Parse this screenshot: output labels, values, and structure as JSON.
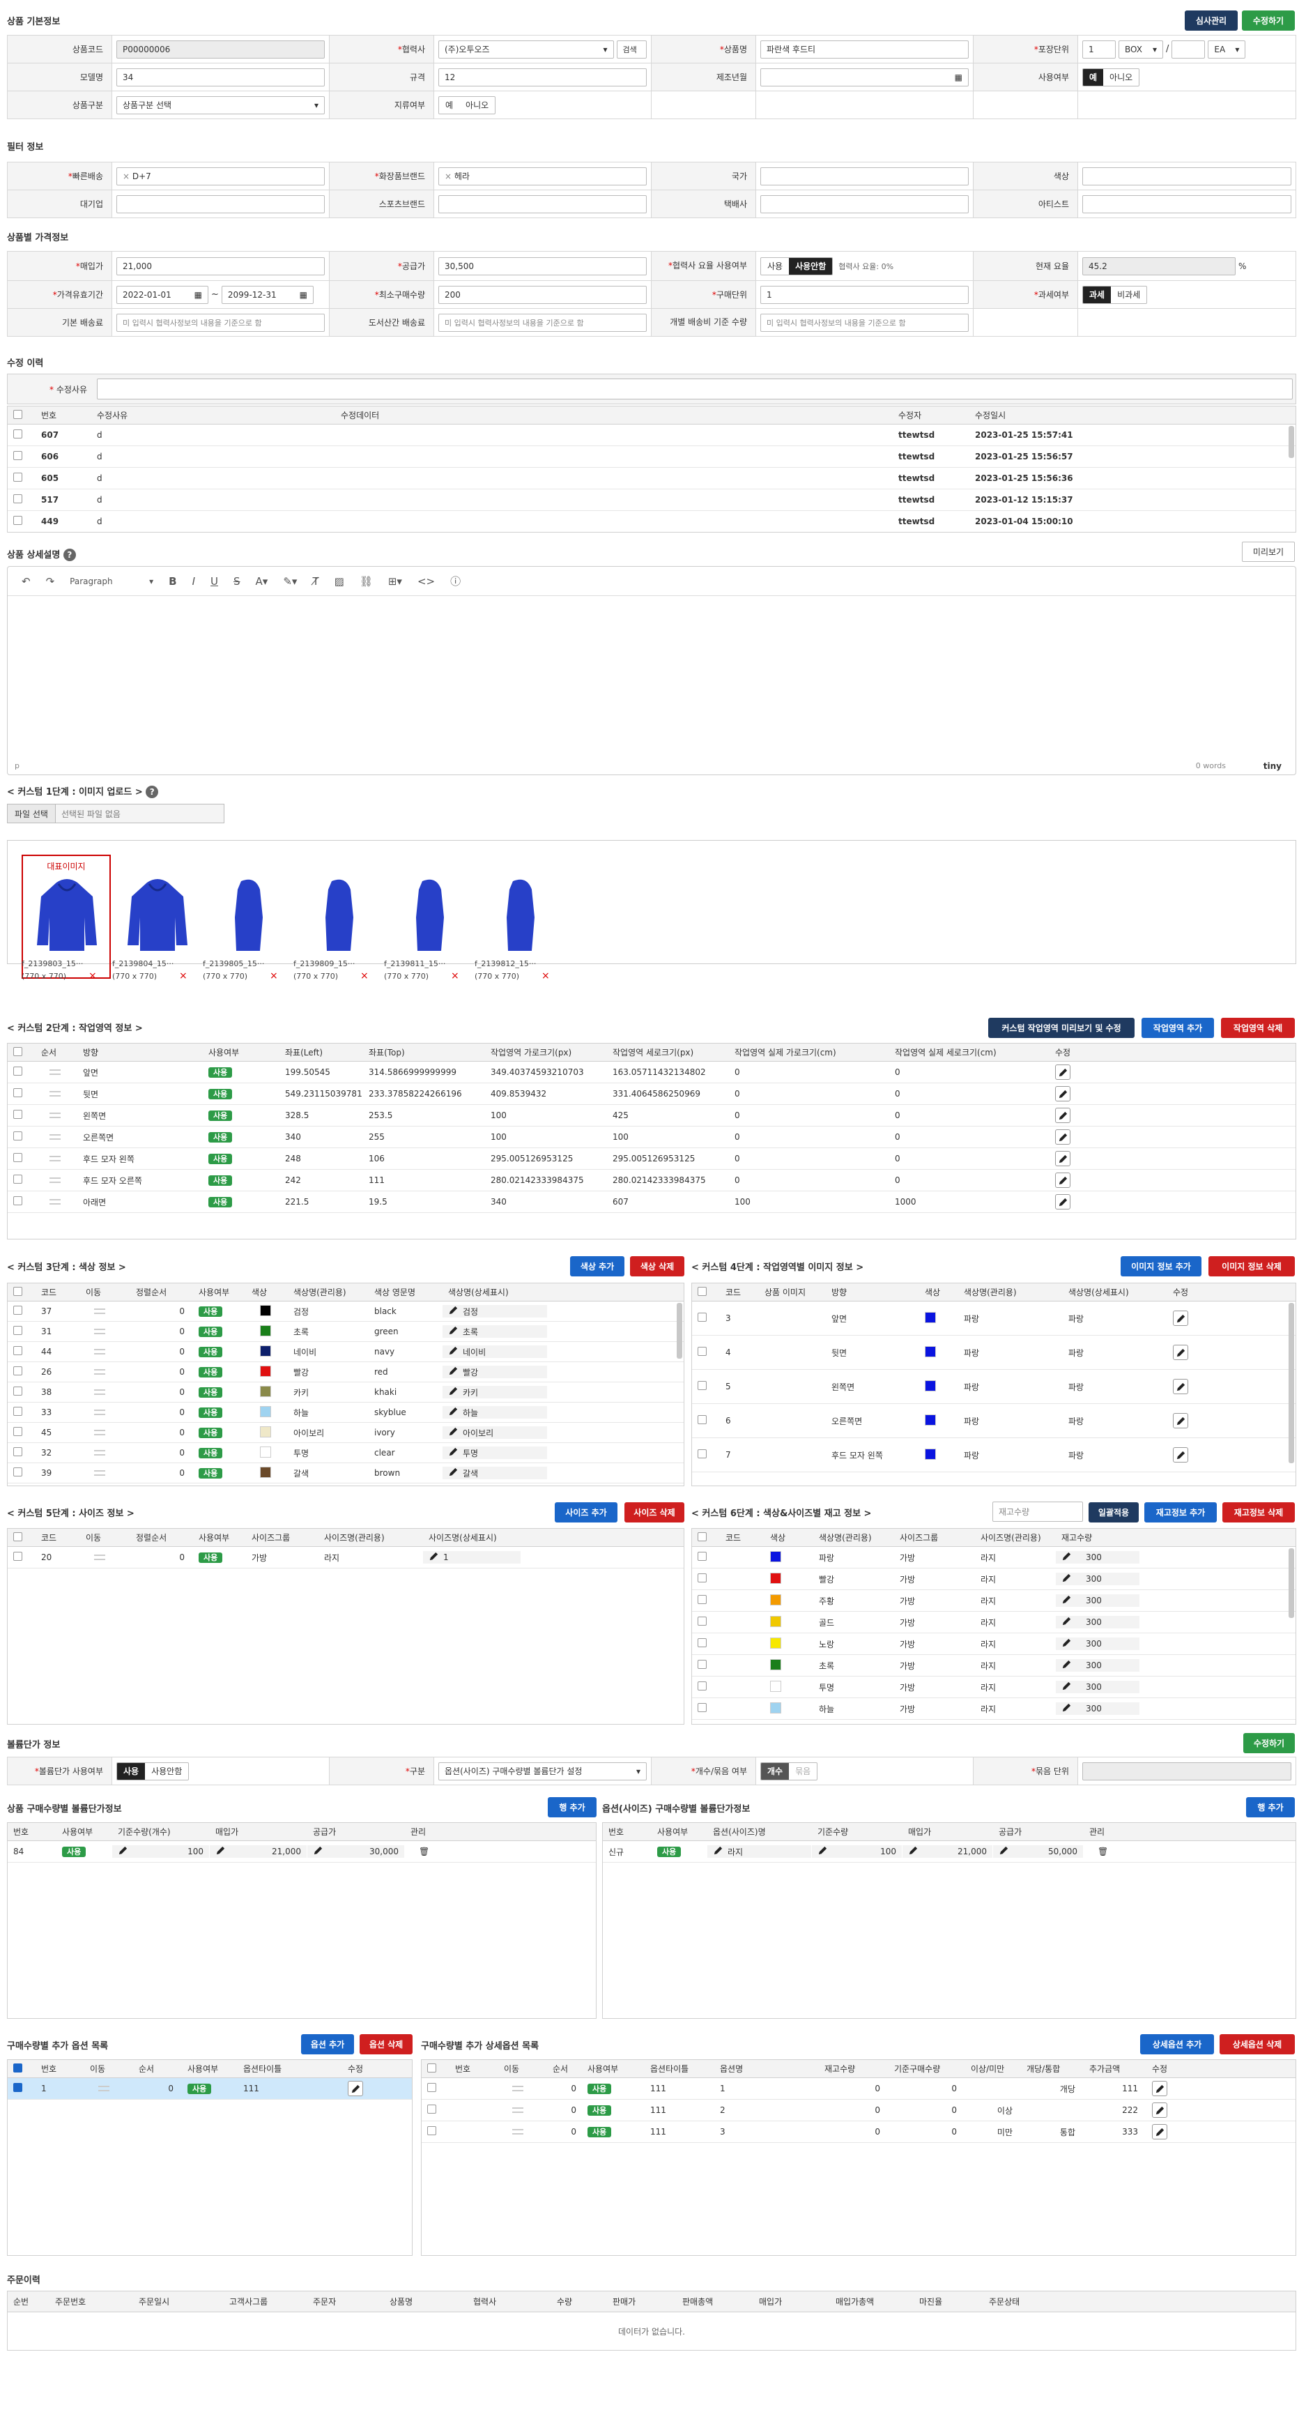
{
  "top": {
    "review_label": "심사관리",
    "save_label": "수정하기"
  },
  "basic": {
    "title": "상품 기본정보",
    "product_code_label": "상품코드",
    "product_code": "P00000006",
    "partner_label": "협력사",
    "partner": "(주)오투오즈",
    "partner_search": "검색",
    "product_name_label": "상품명",
    "product_name": "파란색 후드티",
    "pack_label": "포장단위",
    "pack_qty": "1",
    "pack_unit1": "BOX",
    "pack_unit2": "EA",
    "model_label": "모델명",
    "model": "34",
    "spec_label": "규격",
    "spec": "12",
    "made_label": "제조년월",
    "use_label": "사용여부",
    "yes": "예",
    "no": "아니오",
    "type_label": "상품구분",
    "type": "상품구분 선택",
    "dist_label": "지류여부"
  },
  "filter": {
    "title": "필터 정보",
    "fast_label": "빠른배송",
    "fast_tag": "D+7",
    "cosmetic_label": "화장품브랜드",
    "cosmetic_tag": "헤라",
    "country_label": "국가",
    "color_label": "색상",
    "corp_label": "대기업",
    "sports_label": "스포츠브랜드",
    "parcel_label": "택배사",
    "artist_label": "아티스트"
  },
  "price": {
    "title": "상품별 가격정보",
    "buy_label": "매입가",
    "buy": "21,000",
    "supply_label": "공급가",
    "supply": "30,500",
    "fee_use_label": "협력사 요율 사용여부",
    "fee_use": "사용",
    "fee_unuse": "사용안함",
    "fee_note": "협력사 요율: 0%",
    "cur_fee_label": "현재 요율",
    "cur_fee": "45.2",
    "pct": "%",
    "period_label": "가격유효기간",
    "date_from": "2022-01-01",
    "date_to": "2099-12-31",
    "tilde": "~",
    "minqty_label": "최소구매수량",
    "minqty": "200",
    "buy_unit_label": "구매단위",
    "buy_unit": "1",
    "tax_label": "과세여부",
    "tax": "과세",
    "notax": "비과세",
    "ship_label": "기본 배송료",
    "ship_ph": "미 입력시 협력사정보의 내용을 기준으로 함",
    "island_label": "도서산간 배송료",
    "island_ph": "미 입력시 협력사정보의 내용을 기준으로 함",
    "each_label": "개별 배송비 기준 수량",
    "each_ph": "미 입력시 협력사정보의 내용을 기준으로 함"
  },
  "history": {
    "title": "수정 이력",
    "reason_label": "수정사유",
    "cols": [
      "번호",
      "수정사유",
      "수정데이터",
      "수정자",
      "수정일시"
    ],
    "rows": [
      [
        "607",
        "d",
        "",
        "ttewtsd",
        "2023-01-25 15:57:41"
      ],
      [
        "606",
        "d",
        "",
        "ttewtsd",
        "2023-01-25 15:56:57"
      ],
      [
        "605",
        "d",
        "",
        "ttewtsd",
        "2023-01-25 15:56:36"
      ],
      [
        "517",
        "d",
        "",
        "ttewtsd",
        "2023-01-12 15:15:37"
      ],
      [
        "449",
        "d",
        "",
        "ttewtsd",
        "2023-01-04 15:00:10"
      ]
    ]
  },
  "desc": {
    "title": "상품 상세설명",
    "preview": "미리보기",
    "format": "Paragraph",
    "path": "p",
    "words": "0 words",
    "brand": "tiny"
  },
  "custom1": {
    "title": "< 커스텀 1단계 : 이미지 업로드 >",
    "file_btn": "파일 선택",
    "file_none": "선택된 파일 없음",
    "main_label": "대표이미지",
    "images": [
      {
        "name": "f_2139803_15···",
        "size": "(770 x 770)"
      },
      {
        "name": "f_2139804_15···",
        "size": "(770 x 770)"
      },
      {
        "name": "f_2139805_15···",
        "size": "(770 x 770)"
      },
      {
        "name": "f_2139809_15···",
        "size": "(770 x 770)"
      },
      {
        "name": "f_2139811_15···",
        "size": "(770 x 770)"
      },
      {
        "name": "f_2139812_15···",
        "size": "(770 x 770)"
      }
    ],
    "remove": "×"
  },
  "custom2": {
    "title": "< 커스텀 2단계 : 작업영역 정보 >",
    "preview_btn": "커스텀 작업영역 미리보기 및 수정",
    "add_btn": "작업영역 추가",
    "del_btn": "작업영역 삭제",
    "cols": [
      "순서",
      "방향",
      "사용여부",
      "좌표(Left)",
      "좌표(Top)",
      "작업영역 가로크기(px)",
      "작업영역 세로크기(px)",
      "작업영역 실제 가로크기(cm)",
      "작업영역 실제 세로크기(cm)",
      "수정"
    ],
    "rows": [
      [
        "앞면",
        "199.50545",
        "314.5866999999999",
        "349.40374593210703",
        "163.05711432134802",
        "0",
        "0"
      ],
      [
        "뒷면",
        "549.2311503978117",
        "233.37858224266196",
        "409.8539432",
        "331.4064586250969",
        "0",
        "0"
      ],
      [
        "왼쪽면",
        "328.5",
        "253.5",
        "100",
        "425",
        "0",
        "0"
      ],
      [
        "오른쪽면",
        "340",
        "255",
        "100",
        "100",
        "0",
        "0"
      ],
      [
        "후드 모자 왼쪽",
        "248",
        "106",
        "295.005126953125",
        "295.005126953125",
        "0",
        "0"
      ],
      [
        "후드 모자 오른쪽",
        "242",
        "111",
        "280.02142333984375",
        "280.02142333984375",
        "0",
        "0"
      ],
      [
        "아래면",
        "221.5",
        "19.5",
        "340",
        "607",
        "100",
        "1000"
      ]
    ],
    "use": "사용"
  },
  "custom3": {
    "title": "< 커스텀 3단계 : 색상 정보 >",
    "add_btn": "색상 추가",
    "del_btn": "색상 삭제",
    "cols": [
      "코드",
      "이동",
      "정렬순서",
      "사용여부",
      "색상",
      "색상명(관리용)",
      "색상 영문명",
      "색상명(상세표시)"
    ],
    "rows": [
      {
        "code": "37",
        "order": "0",
        "color": "#000000",
        "name": "검정",
        "en": "black",
        "disp": "검정"
      },
      {
        "code": "31",
        "order": "0",
        "color": "#1a7f1a",
        "name": "초록",
        "en": "green",
        "disp": "초록"
      },
      {
        "code": "44",
        "order": "0",
        "color": "#0d1f6b",
        "name": "네이비",
        "en": "navy",
        "disp": "네이비"
      },
      {
        "code": "26",
        "order": "0",
        "color": "#e01010",
        "name": "빨강",
        "en": "red",
        "disp": "빨강"
      },
      {
        "code": "38",
        "order": "0",
        "color": "#8a8a4a",
        "name": "카키",
        "en": "khaki",
        "disp": "카키"
      },
      {
        "code": "33",
        "order": "0",
        "color": "#9fd3f0",
        "name": "하늘",
        "en": "skyblue",
        "disp": "하늘"
      },
      {
        "code": "45",
        "order": "0",
        "color": "#efe8c8",
        "name": "아이보리",
        "en": "ivory",
        "disp": "아이보리"
      },
      {
        "code": "32",
        "order": "0",
        "color": "#ffffff",
        "name": "투명",
        "en": "clear",
        "disp": "투명"
      },
      {
        "code": "39",
        "order": "0",
        "color": "#6b4a2a",
        "name": "갈색",
        "en": "brown",
        "disp": "갈색"
      }
    ],
    "use": "사용"
  },
  "custom4": {
    "title": "< 커스텀 4단계 : 작업영역별 이미지 정보 >",
    "add_btn": "이미지 정보 추가",
    "del_btn": "이미지 정보 삭제",
    "cols": [
      "코드",
      "상품 이미지",
      "방향",
      "색상",
      "색상명(관리용)",
      "색상명(상세표시)",
      "수정"
    ],
    "rows": [
      [
        "3",
        "앞면",
        "파랑",
        "파랑"
      ],
      [
        "4",
        "뒷면",
        "파랑",
        "파랑"
      ],
      [
        "5",
        "왼쪽면",
        "파랑",
        "파랑"
      ],
      [
        "6",
        "오른쪽면",
        "파랑",
        "파랑"
      ],
      [
        "7",
        "후드 모자 왼쪽",
        "파랑",
        "파랑"
      ]
    ],
    "swatch": "#0a14e0"
  },
  "custom5": {
    "title": "< 커스텀 5단계 : 사이즈 정보 >",
    "add_btn": "사이즈 추가",
    "del_btn": "사이즈 삭제",
    "cols": [
      "코드",
      "이동",
      "정렬순서",
      "사용여부",
      "사이즈그룹",
      "사이즈명(관리용)",
      "사이즈명(상세표시)"
    ],
    "rows": [
      [
        "20",
        "0",
        "가방",
        "라지",
        "1"
      ]
    ],
    "use": "사용"
  },
  "custom6": {
    "title": "< 커스텀 6단계 : 색상&사이즈별 재고 정보 >",
    "stock_ph": "재고수량",
    "bulk_btn": "일괄적용",
    "add_btn": "재고정보 추가",
    "del_btn": "재고정보 삭제",
    "cols": [
      "코드",
      "색상",
      "색상명(관리용)",
      "사이즈그룹",
      "사이즈명(관리용)",
      "재고수량"
    ],
    "rows": [
      {
        "color": "#0a14e0",
        "name": "파랑",
        "group": "가방",
        "size": "라지",
        "qty": "300"
      },
      {
        "color": "#e01010",
        "name": "빨강",
        "group": "가방",
        "size": "라지",
        "qty": "300"
      },
      {
        "color": "#f39a00",
        "name": "주황",
        "group": "가방",
        "size": "라지",
        "qty": "300"
      },
      {
        "color": "#f0c800",
        "name": "골드",
        "group": "가방",
        "size": "라지",
        "qty": "300"
      },
      {
        "color": "#f7e800",
        "name": "노랑",
        "group": "가방",
        "size": "라지",
        "qty": "300"
      },
      {
        "color": "#1a7f1a",
        "name": "초록",
        "group": "가방",
        "size": "라지",
        "qty": "300"
      },
      {
        "color": "#ffffff",
        "name": "투명",
        "group": "가방",
        "size": "라지",
        "qty": "300"
      },
      {
        "color": "#9fd3f0",
        "name": "하늘",
        "group": "가방",
        "size": "라지",
        "qty": "300"
      }
    ]
  },
  "bulk": {
    "title": "볼륨단가 정보",
    "save": "수정하기",
    "use_label": "볼륨단가 사용여부",
    "use": "사용",
    "unuse": "사용안함",
    "kind_label": "구분",
    "kind": "옵션(사이즈) 구매수량별 볼륨단가 설정",
    "qty_label": "개수/묶음 여부",
    "qty": "개수",
    "bundle": "묶음",
    "unit_label": "묶음 단위"
  },
  "bulkA": {
    "title": "상품 구매수량별 볼륨단가정보",
    "add": "행 추가",
    "cols": [
      "번호",
      "사용여부",
      "기준수량(개수)",
      "매입가",
      "공급가",
      "관리"
    ],
    "row": [
      "84",
      "사용",
      "100",
      "21,000",
      "30,000"
    ]
  },
  "bulkB": {
    "title": "옵션(사이즈) 구매수량별 볼륨단가정보",
    "add": "행 추가",
    "cols": [
      "번호",
      "사용여부",
      "옵션(사이즈)명",
      "기준수량",
      "매입가",
      "공급가",
      "관리"
    ],
    "row": [
      "신규",
      "사용",
      "라지",
      "100",
      "21,000",
      "50,000"
    ]
  },
  "optA": {
    "title": "구매수량별 추가 옵션 목록",
    "add": "옵션 추가",
    "del": "옵션 삭제",
    "cols": [
      "번호",
      "이동",
      "순서",
      "사용여부",
      "옵션타이틀",
      "수정"
    ],
    "row": [
      "1",
      "0",
      "사용",
      "111"
    ]
  },
  "optB": {
    "title": "구매수량별 추가 상세옵션 목록",
    "add": "상세옵션 추가",
    "del": "상세옵션 삭제",
    "cols": [
      "번호",
      "이동",
      "순서",
      "사용여부",
      "옵션타이틀",
      "옵션명",
      "재고수량",
      "기준구매수량",
      "이상/미만",
      "개당/통합",
      "추가금액",
      "수정"
    ],
    "rows": [
      [
        "0",
        "사용",
        "111",
        "1",
        "0",
        "0",
        "",
        "개당",
        "111"
      ],
      [
        "0",
        "사용",
        "111",
        "2",
        "0",
        "0",
        "이상",
        "",
        "222"
      ],
      [
        "0",
        "사용",
        "111",
        "3",
        "0",
        "0",
        "미만",
        "통합",
        "333"
      ]
    ]
  },
  "orders": {
    "title": "주문이력",
    "cols": [
      "순번",
      "주문번호",
      "주문일시",
      "고객사그룹",
      "주문자",
      "상품명",
      "협력사",
      "수량",
      "판매가",
      "판매총액",
      "매입가",
      "매입가총액",
      "마진율",
      "주문상태"
    ],
    "empty": "데이터가 없습니다."
  }
}
